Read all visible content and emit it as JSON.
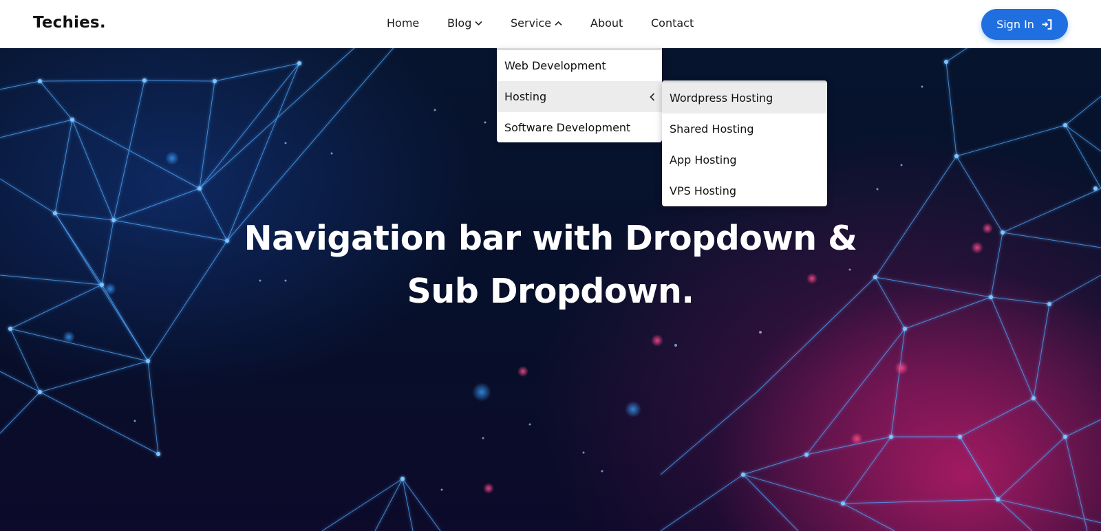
{
  "brand": {
    "logo": "Techies."
  },
  "nav": {
    "home": "Home",
    "blog": "Blog",
    "service": "Service",
    "about": "About",
    "contact": "Contact",
    "signin": "Sign In"
  },
  "icons": {
    "blog_chevron": "chevron-down-icon",
    "service_chevron": "chevron-up-icon",
    "signin_icon": "sign-in-icon",
    "hosting_chevron": "chevron-left-icon"
  },
  "dropdown": {
    "items": [
      {
        "label": "Web Development"
      },
      {
        "label": "Hosting"
      },
      {
        "label": "Software Development"
      }
    ]
  },
  "subdropdown": {
    "items": [
      {
        "label": "Wordpress Hosting"
      },
      {
        "label": "Shared Hosting"
      },
      {
        "label": "App Hosting"
      },
      {
        "label": "VPS Hosting"
      }
    ]
  },
  "hero": {
    "title_line1": "Navigation bar with Dropdown &",
    "title_line2": "Sub Dropdown."
  },
  "colors": {
    "accent": "#1f6fe0",
    "hover_bg": "#ececec",
    "hero_bg": "#070f2a"
  }
}
